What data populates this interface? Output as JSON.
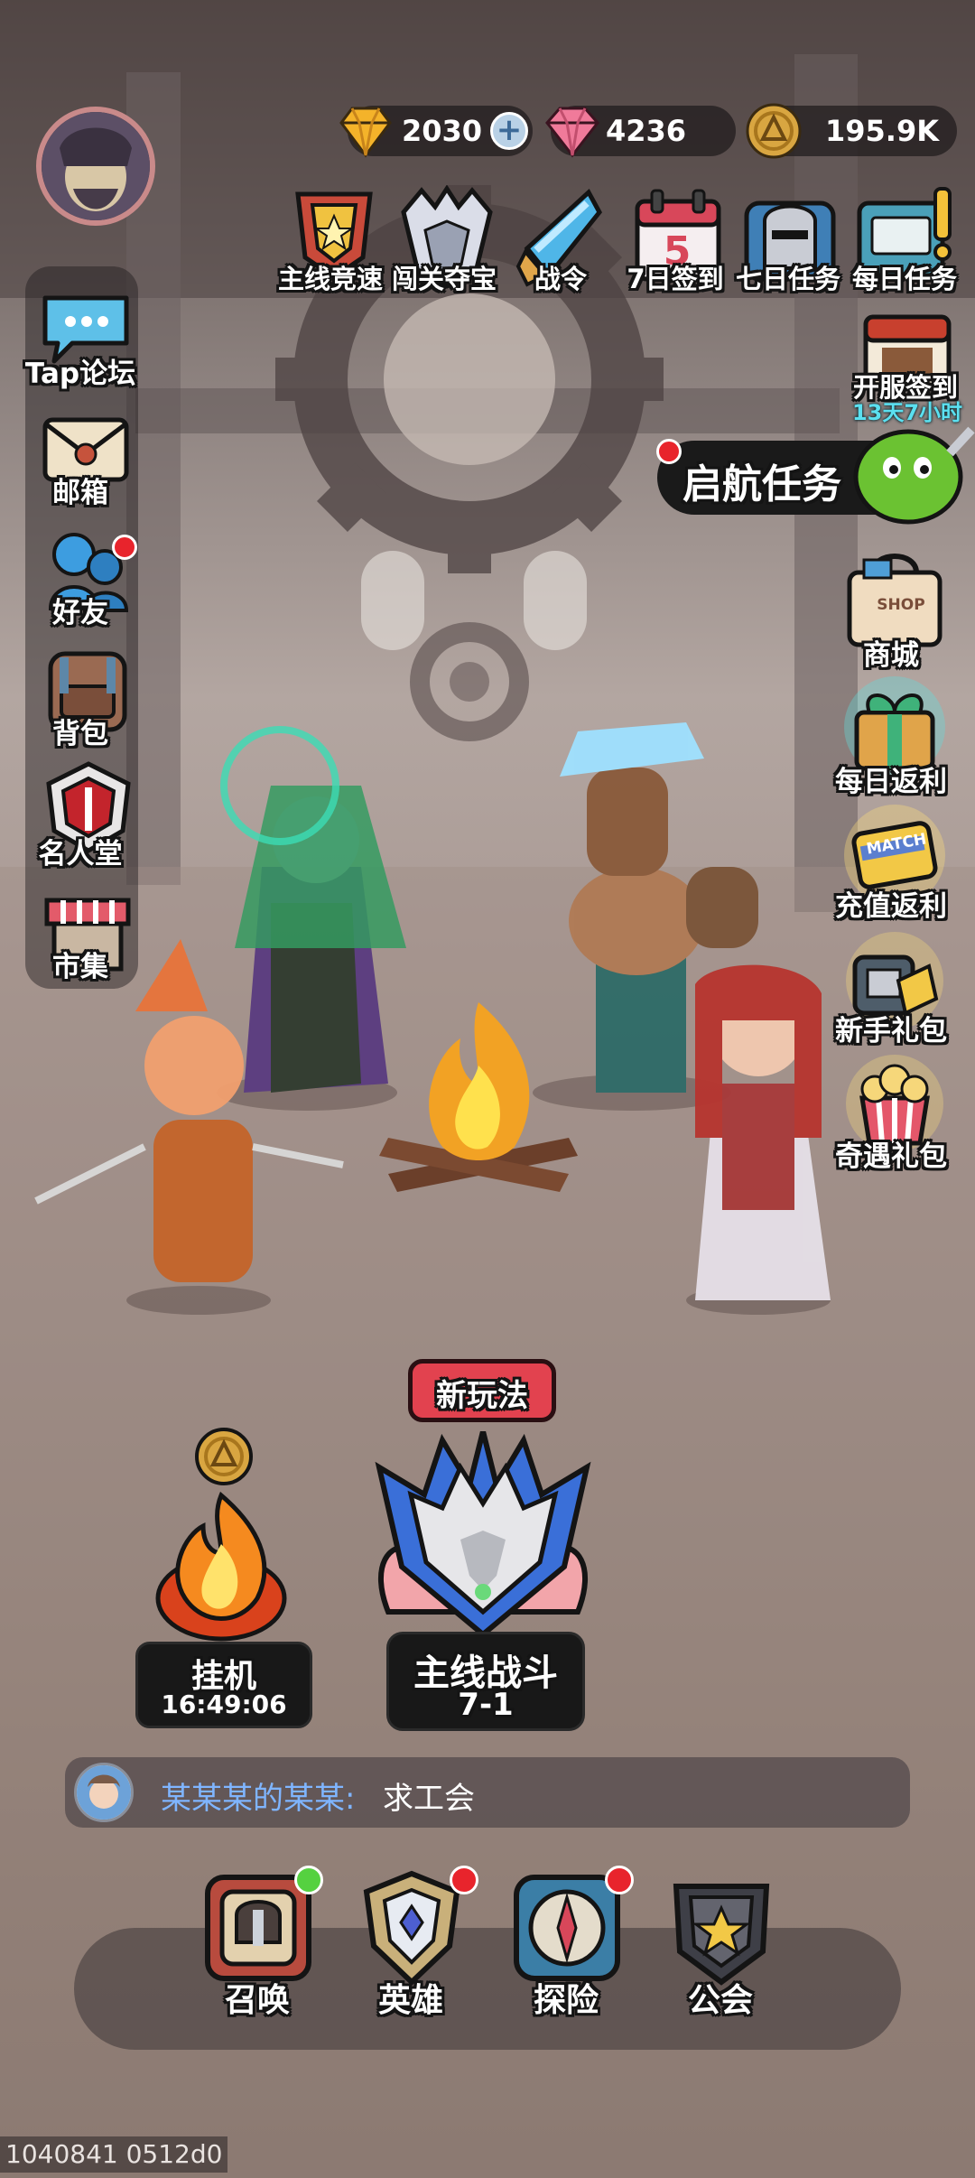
{
  "resources": {
    "gold_ingot": "2030",
    "gem": "4236",
    "coin": "195.9K"
  },
  "top_menu": [
    {
      "label": "主线竞速",
      "icon": "trophy-icon"
    },
    {
      "label": "闯关夺宝",
      "icon": "wolf-crest-icon"
    },
    {
      "label": "战令",
      "icon": "war-order-icon"
    },
    {
      "label": "7日签到",
      "icon": "calendar-icon",
      "day": "5"
    },
    {
      "label": "七日任务",
      "icon": "helmet-icon"
    },
    {
      "label": "每日任务",
      "icon": "task-board-icon"
    }
  ],
  "server_signin": {
    "label": "开服签到",
    "countdown": "13天7小时"
  },
  "voyage_task": {
    "label": "启航任务"
  },
  "left_menu": [
    {
      "label": "Tap论坛",
      "icon": "chat-bubble-icon"
    },
    {
      "label": "邮箱",
      "icon": "mail-icon"
    },
    {
      "label": "好友",
      "icon": "friends-icon"
    },
    {
      "label": "背包",
      "icon": "backpack-icon"
    },
    {
      "label": "名人堂",
      "icon": "hall-of-fame-icon"
    },
    {
      "label": "市集",
      "icon": "market-icon"
    }
  ],
  "right_menu": [
    {
      "label": "商城",
      "icon": "shop-bag-icon",
      "tag": "SHOP"
    },
    {
      "label": "每日返利",
      "icon": "gift-box-icon"
    },
    {
      "label": "充值返利",
      "icon": "match-card-icon",
      "tag": "MATCH"
    },
    {
      "label": "新手礼包",
      "icon": "starter-pack-icon"
    },
    {
      "label": "奇遇礼包",
      "icon": "popcorn-gift-icon"
    }
  ],
  "idle": {
    "label": "挂机",
    "timer": "16:49:06"
  },
  "main_battle": {
    "badge": "新玩法",
    "label": "主线战斗",
    "stage": "7-1"
  },
  "chat": {
    "sender": "某某某的某某:",
    "message": "求工会"
  },
  "bottom_nav": [
    {
      "label": "召唤",
      "icon": "summon-icon",
      "dot": "green"
    },
    {
      "label": "英雄",
      "icon": "hero-icon",
      "dot": "red"
    },
    {
      "label": "探险",
      "icon": "compass-icon",
      "dot": "red"
    },
    {
      "label": "公会",
      "icon": "guild-shield-icon",
      "dot": "none"
    }
  ],
  "build_id": "1040841 0512d0",
  "colors": {
    "red_dot": "#e8242c",
    "green_dot": "#55d140",
    "chat_name": "#7fb5ff",
    "badge_red": "#e2424f",
    "countdown_cyan": "#5be0f0"
  }
}
